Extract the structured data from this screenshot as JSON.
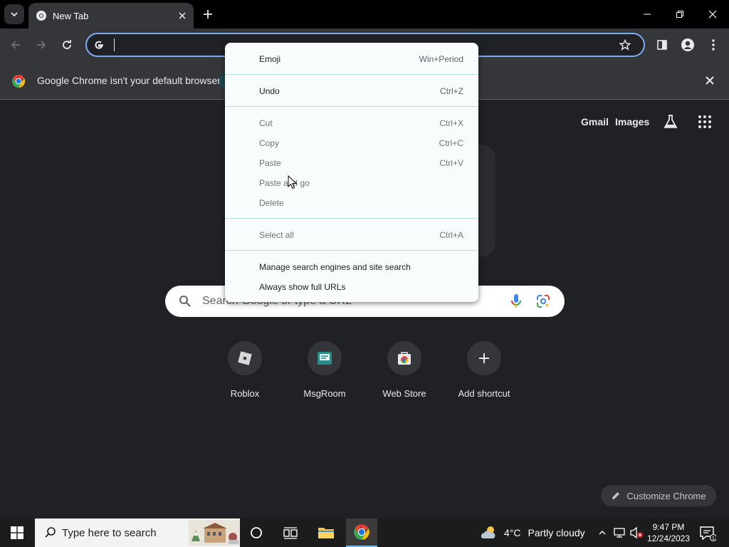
{
  "browser": {
    "tab": {
      "title": "New Tab"
    },
    "omnibox": {
      "value": "",
      "placeholder": ""
    }
  },
  "infobar": {
    "message": "Google Chrome isn't your default browser"
  },
  "ntp": {
    "header_links": [
      "Gmail",
      "Images"
    ],
    "search": {
      "placeholder": "Search Google or type a URL"
    },
    "shortcuts": [
      {
        "label": "Roblox",
        "icon": "roblox-icon"
      },
      {
        "label": "MsgRoom",
        "icon": "msgroom-icon"
      },
      {
        "label": "Web Store",
        "icon": "web-store-icon"
      },
      {
        "label": "Add shortcut",
        "icon": "plus-icon"
      }
    ],
    "customize_label": "Customize Chrome"
  },
  "context_menu": {
    "items": [
      {
        "label": "Emoji",
        "shortcut": "Win+Period",
        "enabled": true
      },
      {
        "label": "Undo",
        "shortcut": "Ctrl+Z",
        "enabled": true
      },
      {
        "label": "Cut",
        "shortcut": "Ctrl+X",
        "enabled": false
      },
      {
        "label": "Copy",
        "shortcut": "Ctrl+C",
        "enabled": false
      },
      {
        "label": "Paste",
        "shortcut": "Ctrl+V",
        "enabled": false
      },
      {
        "label": "Paste and go",
        "shortcut": "",
        "enabled": false
      },
      {
        "label": "Delete",
        "shortcut": "",
        "enabled": false
      },
      {
        "label": "Select all",
        "shortcut": "Ctrl+A",
        "enabled": false
      },
      {
        "label": "Manage search engines and site search",
        "shortcut": "",
        "enabled": true
      },
      {
        "label": "Always show full URLs",
        "shortcut": "",
        "enabled": true
      }
    ]
  },
  "taskbar": {
    "search_placeholder": "Type here to search",
    "weather": {
      "temp": "4°C",
      "desc": "Partly cloudy"
    },
    "clock": {
      "time": "9:47 PM",
      "date": "12/24/2023"
    }
  },
  "colors": {
    "accent": "#7cacf8",
    "menu_bg": "#f8fcfd",
    "toolbar": "#35363a",
    "page_bg": "#202124"
  }
}
